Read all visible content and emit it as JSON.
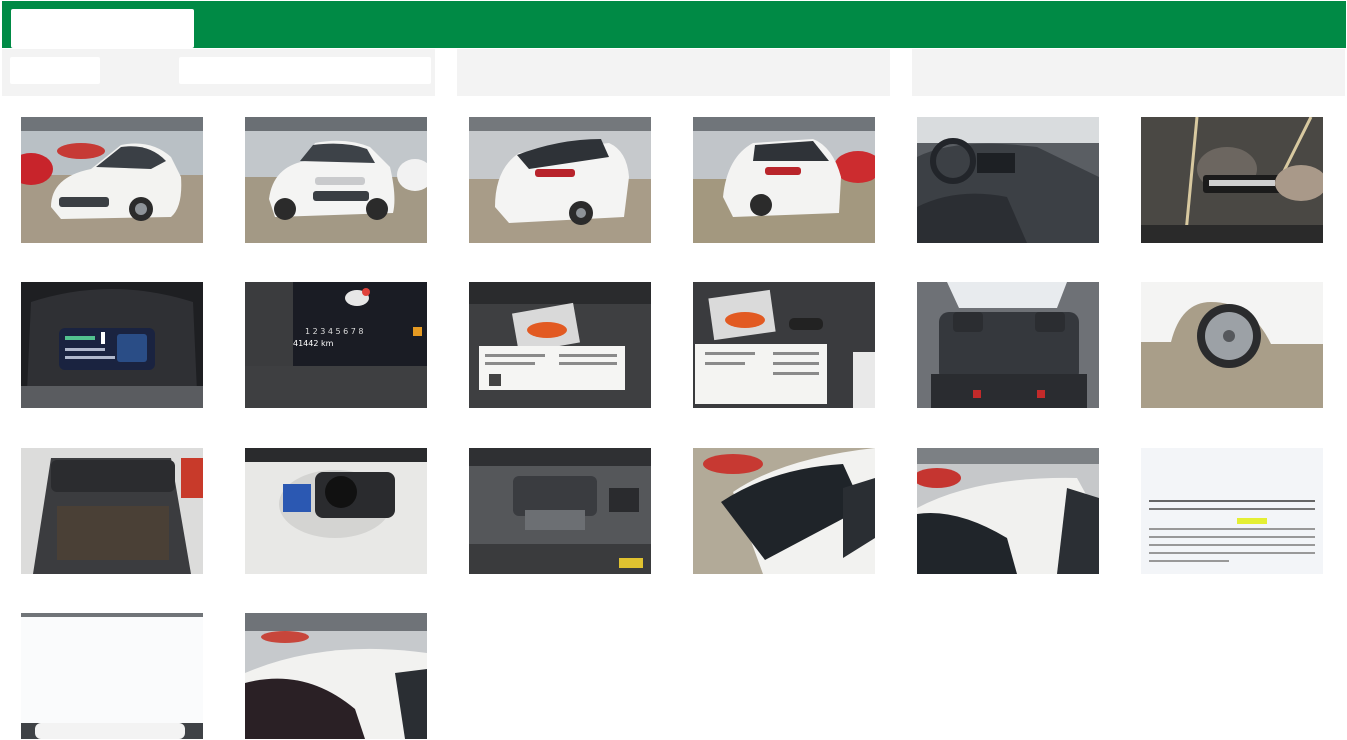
{
  "header": {
    "brand_color": "#008a45"
  },
  "gallery": {
    "photos": [
      {
        "subject": "front three-quarter view, white hatchback"
      },
      {
        "subject": "front view, white hatchback"
      },
      {
        "subject": "rear three-quarter view"
      },
      {
        "subject": "rear view"
      },
      {
        "subject": "interior driver side dashboard"
      },
      {
        "subject": "key fob reflection"
      },
      {
        "subject": "digital instrument cluster"
      },
      {
        "subject": "odometer display",
        "odometer": "41442 km",
        "gears": "1 2 3 4 5 6 7 8"
      },
      {
        "subject": "service booklet and brochure"
      },
      {
        "subject": "service booklet with key"
      },
      {
        "subject": "rear seats"
      },
      {
        "subject": "alloy wheel"
      },
      {
        "subject": "open trunk"
      },
      {
        "subject": "spare wheel well"
      },
      {
        "subject": "engine bay"
      },
      {
        "subject": "windshield and roof"
      },
      {
        "subject": "roof top view"
      },
      {
        "subject": "inspection document"
      },
      {
        "subject": "overexposed photo"
      },
      {
        "subject": "roof rear view"
      }
    ]
  }
}
